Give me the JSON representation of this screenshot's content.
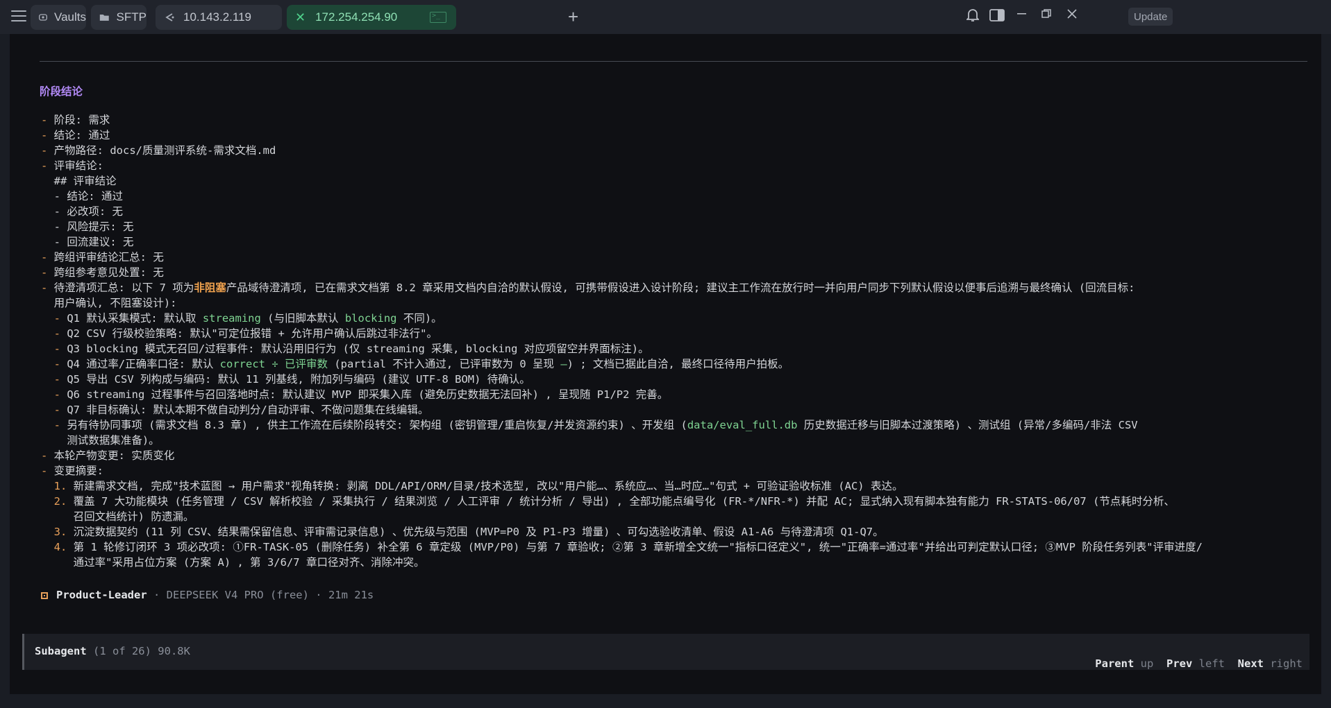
{
  "tabs": [
    {
      "label": "Vaults",
      "icon": "vault-icon"
    },
    {
      "label": "SFTP",
      "icon": "folder-icon"
    },
    {
      "label": "10.143.2.119",
      "icon": "loading-icon"
    },
    {
      "label": "172.254.254.90",
      "icon": "terminal-icon"
    }
  ],
  "toolbar": {
    "update_label": "Update"
  },
  "terminal": {
    "heading": "阶段结论",
    "lines": [
      "- 阶段: 需求",
      "- 结论: 通过",
      "- 产物路径: docs/质量测评系统-需求文档.md",
      "- 评审结论:",
      "  ## 评审结论",
      "  - 结论: 通过",
      "  - 必改项: 无",
      "  - 风险提示: 无",
      "  - 回流建议: 无",
      "- 跨组评审结论汇总: 无",
      "- 跨组参考意见处置: 无",
      "- 待澄清项汇总: 以下 7 项为非阻塞产品域待澄清项, 已在需求文档第 8.2 章采用文档内自洽的默认假设, 可携带假设进入设计阶段; 建议主工作流在放行时一并向用户同步下列默认假设以便事后追溯与最终确认 (回流目标:",
      "  用户确认, 不阻塞设计):",
      "  - Q1 默认采集模式: 默认取 streaming (与旧脚本默认 blocking 不同)。",
      "  - Q2 CSV 行级校验策略: 默认\"可定位报错 + 允许用户确认后跳过非法行\"。",
      "  - Q3 blocking 模式无召回/过程事件: 默认沿用旧行为 (仅 streaming 采集, blocking 对应项留空并界面标注)。",
      "  - Q4 通过率/正确率口径: 默认 correct ÷ 已评审数 (partial 不计入通过, 已评审数为 0 呈现 —) ; 文档已据此自洽, 最终口径待用户拍板。",
      "  - Q5 导出 CSV 列构成与编码: 默认 11 列基线, 附加列与编码 (建议 UTF-8 BOM) 待确认。",
      "  - Q6 streaming 过程事件与召回落地时点: 默认建议 MVP 即采集入库 (避免历史数据无法回补) , 呈现随 P1/P2 完善。",
      "  - Q7 非目标确认: 默认本期不做自动判分/自动评审、不做问题集在线编辑。",
      "  - 另有待协同事项 (需求文档 8.3 章) , 供主工作流在后续阶段转交: 架构组 (密钥管理/重启恢复/并发资源约束) 、开发组 (data/eval_full.db 历史数据迁移与旧脚本过渡策略) 、测试组 (异常/多编码/非法 CSV",
      "    测试数据集准备)。",
      "- 本轮产物变更: 实质变化",
      "- 变更摘要:",
      "  1. 新建需求文档, 完成\"技术蓝图 → 用户需求\"视角转换: 剥离 DDL/API/ORM/目录/技术选型, 改以\"用户能…、系统应…、当…时应…\"句式 + 可验证验收标准 (AC) 表达。",
      "  2. 覆盖 7 大功能模块 (任务管理 / CSV 解析校验 / 采集执行 / 结果浏览 / 人工评审 / 统计分析 / 导出) , 全部功能点编号化 (FR-*/NFR-*) 并配 AC; 显式纳入现有脚本独有能力 FR-STATS-06/07 (节点耗时分析、",
      "     召回文档统计) 防遗漏。",
      "  3. 沉淀数据契约 (11 列 CSV、结果需保留信息、评审需记录信息) 、优先级与范围 (MVP=P0 及 P1-P3 增量) 、可勾选验收清单、假设 A1-A6 与待澄清项 Q1-Q7。",
      "  4. 第 1 轮修订闭环 3 项必改项: ①FR-TASK-05 (删除任务) 补全第 6 章定级 (MVP/P0) 与第 7 章验收; ②第 3 章新增全文统一\"指标口径定义\", 统一\"正确率=通过率\"并给出可判定默认口径; ③MVP 阶段任务列表\"评审进度/",
      "     通过率\"采用占位方案 (方案 A) , 第 3/6/7 章口径对齐、消除冲突。"
    ],
    "agent": {
      "name": "Product-Leader",
      "meta": " · DEEPSEEK V4 PRO (free) · 21m 21s"
    }
  },
  "footer": {
    "title": "Subagent",
    "count": " (1 of 26) 90.8K",
    "nav": [
      {
        "label": "Parent",
        "key": "up"
      },
      {
        "label": "Prev",
        "key": "left"
      },
      {
        "label": "Next",
        "key": "right"
      }
    ]
  }
}
